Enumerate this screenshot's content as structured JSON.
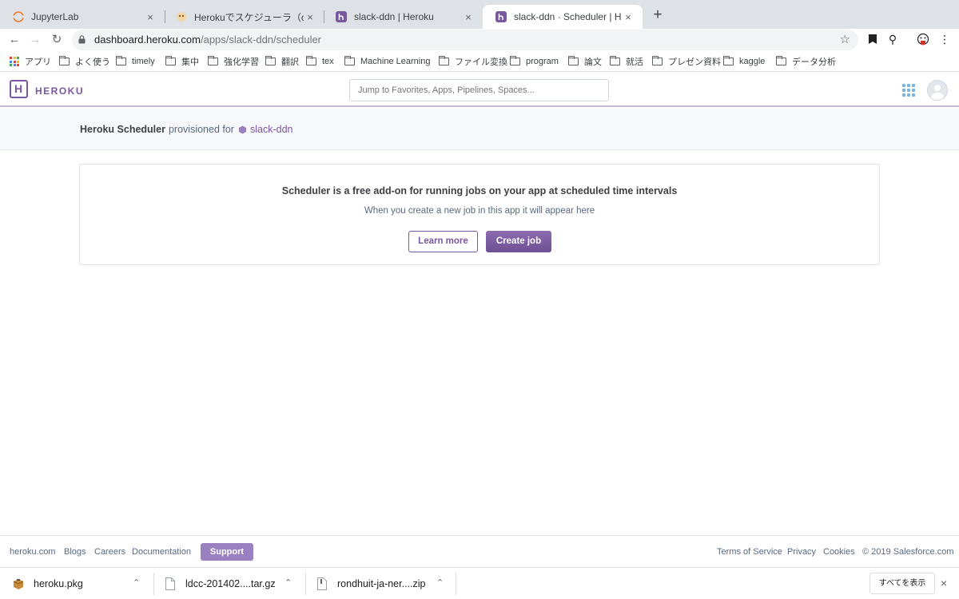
{
  "browser": {
    "tabs": [
      {
        "title": "JupyterLab",
        "close": "×"
      },
      {
        "title": "Herokuでスケジューラ（cron）を",
        "close": "×"
      },
      {
        "title": "slack-ddn | Heroku",
        "close": "×"
      },
      {
        "title": "slack-ddn · Scheduler | Heroku",
        "close": "×"
      }
    ],
    "new_tab": "+",
    "url_host": "dashboard.heroku.com",
    "url_path": "/apps/slack-ddn/scheduler",
    "bookmarks": [
      "アプリ",
      "よく使う",
      "timely",
      "集中",
      "強化学習",
      "翻訳",
      "tex",
      "Machine Learning",
      "ファイル変換",
      "program",
      "論文",
      "就活",
      "プレゼン資料",
      "kaggle",
      "データ分析"
    ]
  },
  "header": {
    "logo_letter": "H",
    "brand": "HEROKU",
    "search_placeholder": "Jump to Favorites, Apps, Pipelines, Spaces..."
  },
  "subheader": {
    "addon_name": "Heroku Scheduler",
    "provisioned_text": "provisioned for",
    "app_name": "slack-ddn"
  },
  "card": {
    "title": "Scheduler is a free add-on for running jobs on your app at scheduled time intervals",
    "subtitle": "When you create a new job in this app it will appear here",
    "learn_more": "Learn more",
    "create_job": "Create job"
  },
  "footer": {
    "links_left": [
      "heroku.com",
      "Blogs",
      "Careers",
      "Documentation"
    ],
    "support": "Support",
    "links_right": [
      "Terms of Service",
      "Privacy",
      "Cookies",
      "© 2019 Salesforce.com"
    ]
  },
  "downloads": {
    "items": [
      "heroku.pkg",
      "ldcc-201402....tar.gz",
      "rondhuit-ja-ner....zip"
    ],
    "show_all": "すべてを表示",
    "close": "×"
  },
  "colors": {
    "brand_purple": "#79589f",
    "support_purple": "#9a80c0"
  }
}
